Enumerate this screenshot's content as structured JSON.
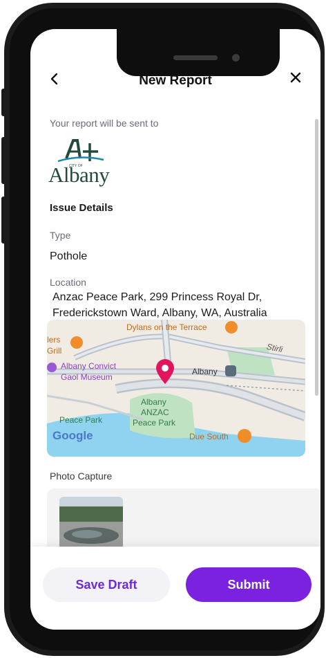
{
  "header": {
    "back_icon": "chevron-left-icon",
    "title": "New Report",
    "close_icon": "close-icon"
  },
  "recipient": {
    "label": "Your report will be sent to",
    "logo_text": "Albany",
    "logo_small_text": "CITY OF"
  },
  "issue_details": {
    "section_title": "Issue Details",
    "type_label": "Type",
    "type_value": "Pothole",
    "location_label": "Location",
    "location_value": "Anzac Peace Park, 299 Princess Royal Dr, Frederickstown Ward, Albany, WA, Australia"
  },
  "map": {
    "labels": {
      "top": "Dylans on the Terrace",
      "lers": "lers",
      "grill": "Grill",
      "stirling": "Stirli",
      "convict1": "Albany Convict",
      "convict2": "Gaol Museum",
      "albany_station": "Albany",
      "anzac1": "Albany",
      "anzac2": "ANZAC",
      "anzac3": "Peace Park",
      "peace_park": "Peace Park",
      "google": "Google",
      "due_south": "Due South"
    },
    "colors": {
      "road": "#b9c2cc",
      "green": "#bfe3c2",
      "water": "#8fd3f0",
      "pin": "#e0155c",
      "poi_orange": "#f08c2a"
    }
  },
  "photo": {
    "section_title": "Photo Capture"
  },
  "footer": {
    "save_label": "Save Draft",
    "submit_label": "Submit"
  },
  "theme": {
    "accent": "#7b22e0",
    "accent_text": "#6b2bd9"
  }
}
